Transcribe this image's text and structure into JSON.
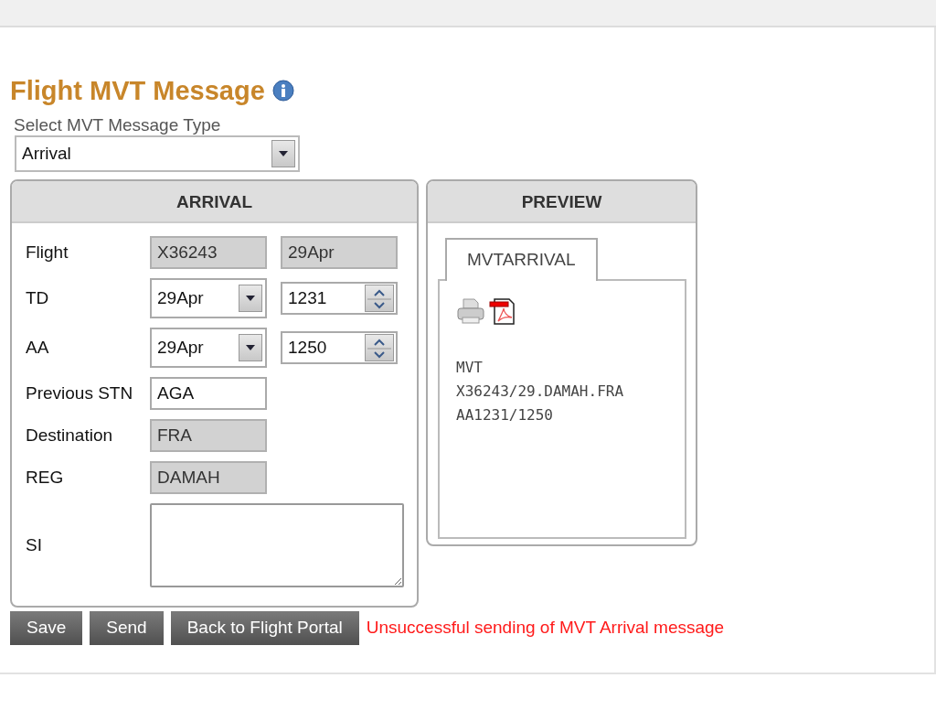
{
  "title": "Flight MVT Message",
  "message_type": {
    "label": "Select MVT Message Type",
    "value": "Arrival"
  },
  "form": {
    "heading": "ARRIVAL",
    "rows": [
      {
        "label": "Flight",
        "fields": [
          {
            "kind": "readonly",
            "value": "X36243"
          },
          {
            "kind": "readonly",
            "value": "29Apr"
          }
        ]
      },
      {
        "label": "TD",
        "fields": [
          {
            "kind": "dropdown",
            "value": "29Apr"
          },
          {
            "kind": "spinner",
            "value": "1231"
          }
        ]
      },
      {
        "label": "AA",
        "fields": [
          {
            "kind": "dropdown",
            "value": "29Apr"
          },
          {
            "kind": "spinner",
            "value": "1250"
          }
        ]
      },
      {
        "label": "Previous STN",
        "fields": [
          {
            "kind": "text",
            "value": "AGA"
          }
        ]
      },
      {
        "label": "Destination",
        "fields": [
          {
            "kind": "readonly",
            "value": "FRA"
          }
        ]
      },
      {
        "label": "REG",
        "fields": [
          {
            "kind": "readonly",
            "value": "DAMAH"
          }
        ]
      },
      {
        "label": "SI",
        "fields": [
          {
            "kind": "textarea"
          }
        ]
      }
    ]
  },
  "preview": {
    "heading": "PREVIEW",
    "tabs": [
      {
        "label": "MVTARRIVAL",
        "selected": true
      }
    ],
    "lines": [
      "MVT",
      "X36243/29.DAMAH.FRA",
      "AA1231/1250"
    ]
  },
  "buttons": [
    "Save",
    "Send",
    "Back to Flight Portal"
  ],
  "status_message": "Unsuccessful sending of MVT Arrival message"
}
